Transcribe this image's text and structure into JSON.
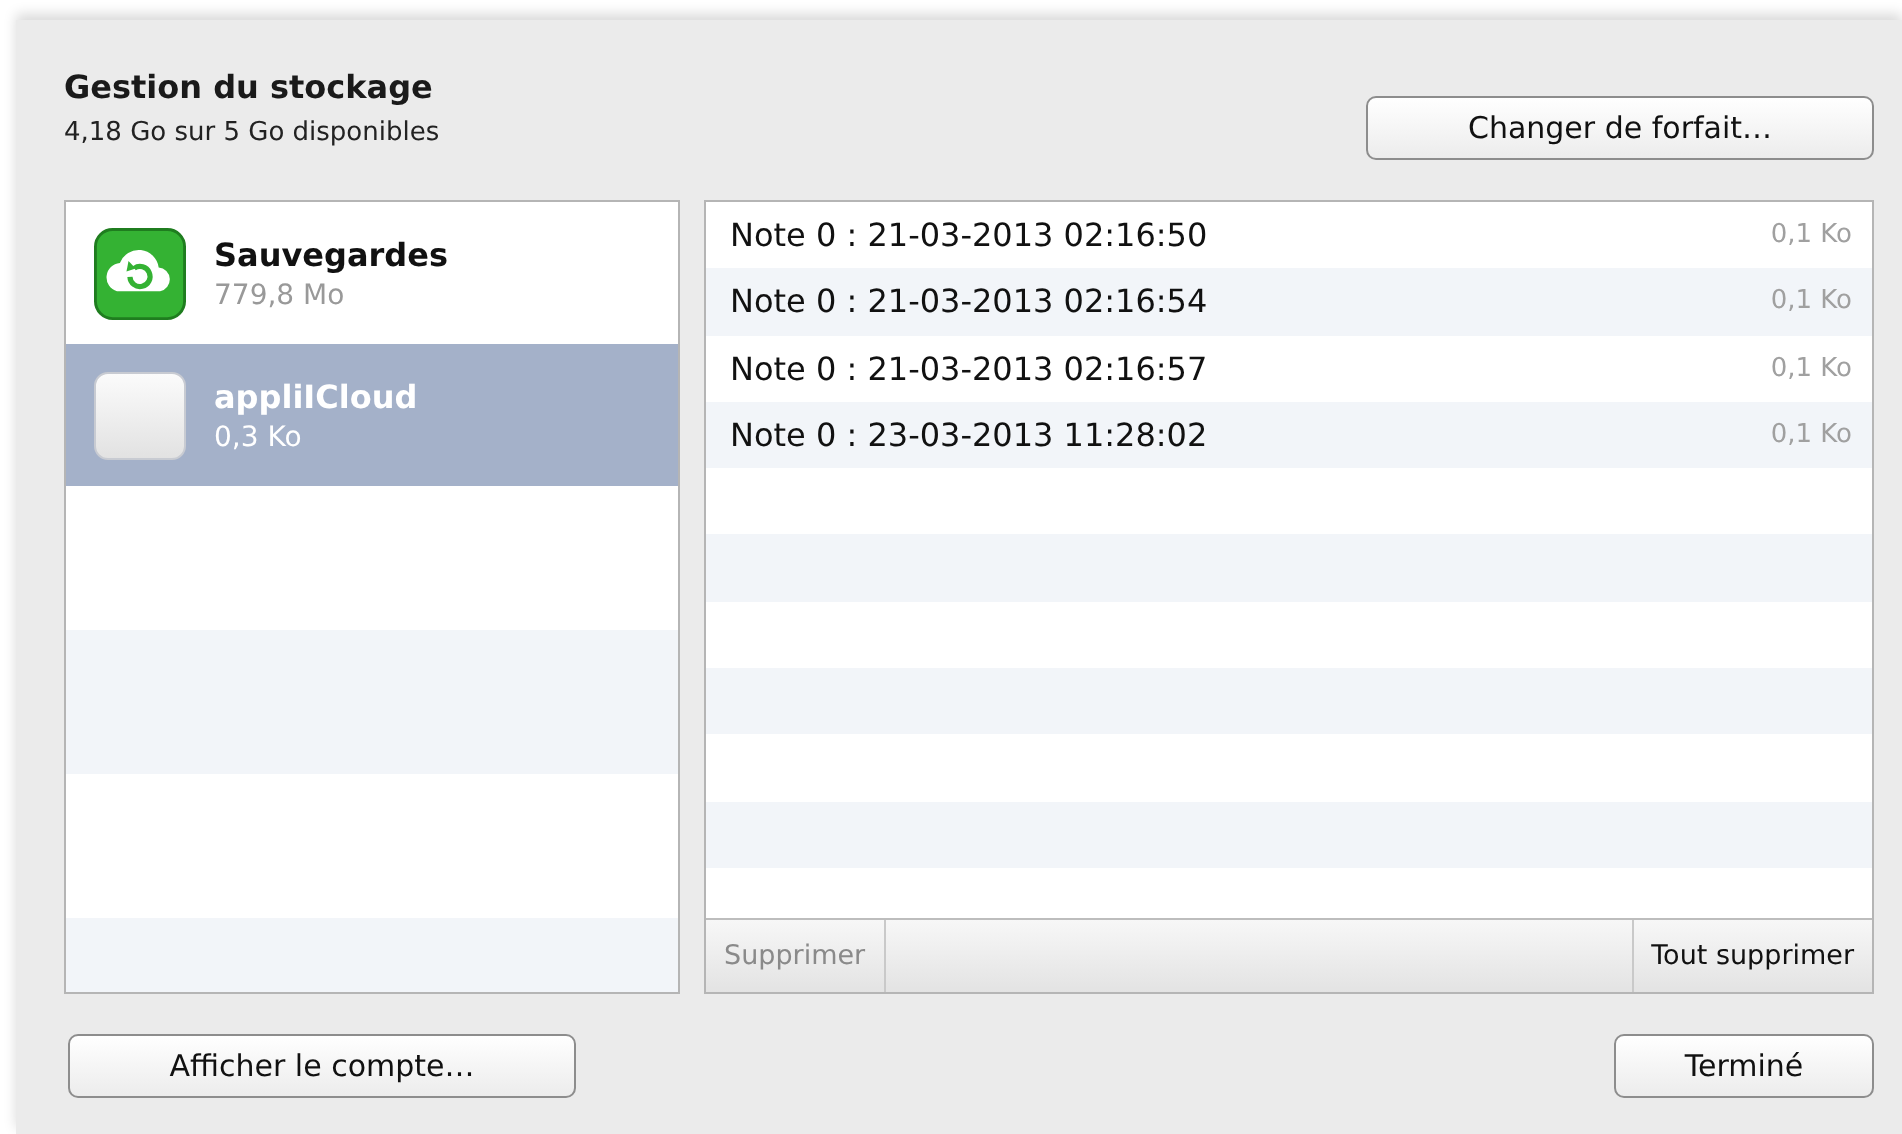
{
  "header": {
    "title": "Gestion du stockage",
    "subtitle": "4,18 Go sur 5 Go disponibles"
  },
  "change_plan_button": "Changer de forfait…",
  "apps": [
    {
      "name": "Sauvegardes",
      "size": "779,8 Mo",
      "kind": "backup",
      "selected": false
    },
    {
      "name": "appliICloud",
      "size": "0,3 Ko",
      "kind": "blank",
      "selected": true
    }
  ],
  "documents": [
    {
      "name": "Note 0 : 21-03-2013 02:16:50",
      "size": "0,1 Ko"
    },
    {
      "name": "Note 0 : 21-03-2013 02:16:54",
      "size": "0,1 Ko"
    },
    {
      "name": "Note 0 : 21-03-2013 02:16:57",
      "size": "0,1 Ko"
    },
    {
      "name": "Note 0 : 23-03-2013 11:28:02",
      "size": "0,1 Ko"
    }
  ],
  "delete_button": {
    "label": "Supprimer",
    "disabled": true
  },
  "delete_all_button": {
    "label": "Tout supprimer",
    "disabled": false
  },
  "account_button": "Afficher le compte…",
  "done_button": "Terminé"
}
